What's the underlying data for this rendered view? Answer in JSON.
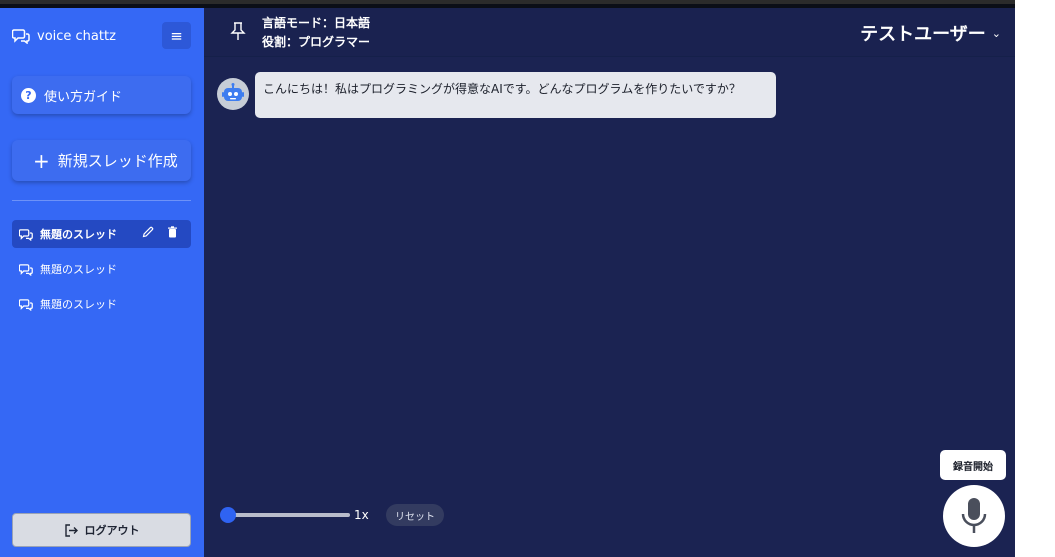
{
  "app": {
    "brand": "voice chattz",
    "menu_icon": "≡"
  },
  "sidebar": {
    "guide_label": "使い方ガイド",
    "guide_icon": "?",
    "new_thread_label": "新規スレッド作成",
    "threads": [
      {
        "label": "無題のスレッド",
        "active": true
      },
      {
        "label": "無題のスレッド",
        "active": false
      },
      {
        "label": "無題のスレッド",
        "active": false
      }
    ],
    "logout_label": "ログアウト"
  },
  "header": {
    "mode_label": "言語モード：日本語",
    "role_label": "役割：プログラマー",
    "user_name": "テストユーザー",
    "user_chevron": "⌄"
  },
  "chat": {
    "messages": [
      {
        "sender": "bot",
        "text": "こんにちは！私はプログラミングが得意なAIです。どんなプログラムを作りたいですか？"
      }
    ]
  },
  "controls": {
    "speed_value": 0,
    "speed_label": "1x",
    "reset_label": "リセット",
    "record_tooltip": "録音開始"
  },
  "colors": {
    "sidebar": "#3568f5",
    "main": "#1b2352",
    "accent": "#2f63f2"
  }
}
